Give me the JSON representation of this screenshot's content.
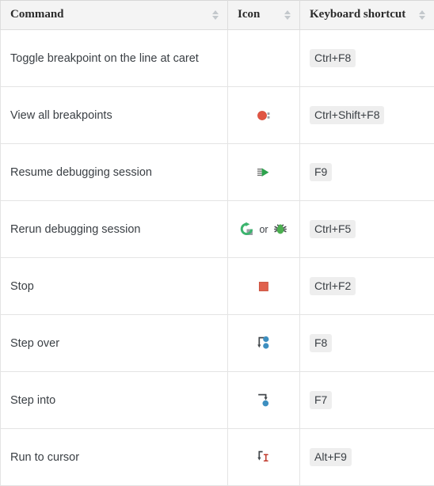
{
  "table": {
    "headers": [
      {
        "label": "Command",
        "sort_icon": "sort-updown-icon"
      },
      {
        "label": "Icon",
        "sort_icon": "sort-updown-icon"
      },
      {
        "label": "Keyboard shortcut",
        "sort_icon": "sort-updown-icon"
      }
    ],
    "rows": [
      {
        "command": "Toggle breakpoint on the line at caret",
        "icons": [],
        "shortcut": "Ctrl+F8"
      },
      {
        "command": "View all breakpoints",
        "icons": [
          "breakpoints-view-icon"
        ],
        "shortcut": "Ctrl+Shift+F8"
      },
      {
        "command": "Resume debugging session",
        "icons": [
          "resume-play-icon"
        ],
        "shortcut": "F9"
      },
      {
        "command": "Rerun debugging session",
        "icons": [
          "rerun-icon",
          "debug-bug-icon"
        ],
        "separator": "or",
        "shortcut": "Ctrl+F5"
      },
      {
        "command": "Stop",
        "icons": [
          "stop-square-icon"
        ],
        "shortcut": "Ctrl+F2"
      },
      {
        "command": "Step over",
        "icons": [
          "step-over-icon"
        ],
        "shortcut": "F8"
      },
      {
        "command": "Step into",
        "icons": [
          "step-into-icon"
        ],
        "shortcut": "F7"
      },
      {
        "command": "Run to cursor",
        "icons": [
          "run-to-cursor-icon"
        ],
        "shortcut": "Alt+F9"
      }
    ]
  },
  "colors": {
    "header_bg": "#f4f4f4",
    "border": "#e4e4e4",
    "kbd_bg": "#eeeeee",
    "text": "#3a3f44",
    "breakpoint_red": "#e05543",
    "stop_red": "#e0614d",
    "resume_green": "#2da24c",
    "rerun_green": "#3cb46e",
    "bug_green": "#4caf50",
    "step_blue": "#3d8fc0",
    "cursor_red": "#c0392b",
    "icon_gray": "#6e6e6e",
    "sort_gray": "#c3c8cc"
  }
}
